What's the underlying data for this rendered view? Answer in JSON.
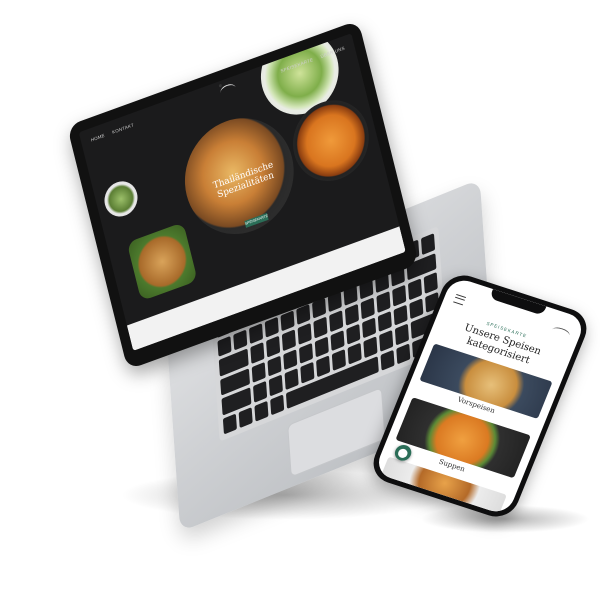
{
  "laptop": {
    "nav_left": [
      "HOME",
      "KONTAKT"
    ],
    "nav_right": [
      "SPEISEKARTE",
      "ÜBER UNS"
    ],
    "hero_heading": "Thailändische Spezialitäten",
    "hero_cta": "SPEISEKARTE"
  },
  "phone": {
    "kicker": "SPEISEKARTE",
    "title": "Unsere Speisen kategorisiert",
    "cards": [
      {
        "label": "Vorspeisen"
      },
      {
        "label": "Suppen"
      }
    ],
    "map_icon": "map-pin-icon"
  },
  "colors": {
    "accent": "#2b6e58",
    "laptop_body": "#cfd1d4",
    "screen_dark": "#1b1b1c"
  }
}
